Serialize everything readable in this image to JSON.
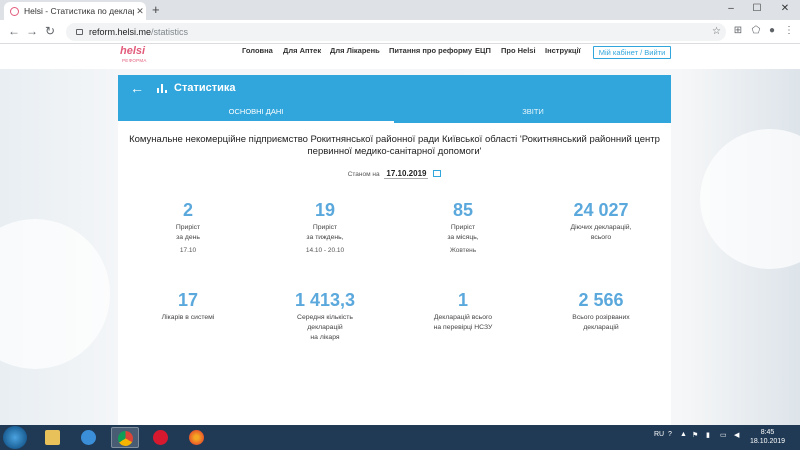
{
  "browser": {
    "tab_title": "Helsi - Статистика по декларац…",
    "url_host": "reform.helsi.me",
    "url_path": "/statistics"
  },
  "header": {
    "logo_text": "helsi",
    "logo_sub": "РЕФОРМА",
    "menu": [
      "Головна",
      "Для Аптек",
      "Для Лікарень",
      "Питання про реформу",
      "ЕЦП",
      "Про Helsi",
      "Інструкції"
    ],
    "cabinet_label": "Мій кабінет / Вийти"
  },
  "card": {
    "title": "Статистика",
    "tabs": [
      "ОСНОВНІ ДАНІ",
      "ЗВІТИ"
    ],
    "org_line1": "Комунальне некомерційне підприємство Рокитнянської районної ради Київської області 'Рокитнянський районний центр",
    "org_line2": "первинної медико-санітарної допомоги'",
    "asof_label": "Станом на",
    "asof_date": "17.10.2019",
    "stats": [
      {
        "num": "2",
        "label": "Приріст\nза день",
        "sub": "17.10"
      },
      {
        "num": "19",
        "label": "Приріст\nза тиждень,",
        "sub": "14.10 - 20.10"
      },
      {
        "num": "85",
        "label": "Приріст\nза місяць,",
        "sub": "Жовтень"
      },
      {
        "num": "24 027",
        "label": "Діючих декларацій,\nвсього",
        "sub": ""
      },
      {
        "num": "17",
        "label": "Лікарів в системі",
        "sub": ""
      },
      {
        "num": "1 413,3",
        "label": "Середня кількість\nдекларацій\nна лікаря",
        "sub": ""
      },
      {
        "num": "1",
        "label": "Декларацій всього\nна перевірці НСЗУ",
        "sub": ""
      },
      {
        "num": "2 566",
        "label": "Всього розірваних\nдекларацій",
        "sub": ""
      }
    ]
  },
  "taskbar": {
    "lang": "RU",
    "time": "8:45",
    "date": "18.10.2019"
  },
  "colors": {
    "accent": "#31a6dc",
    "stat_number": "#5aa8dc",
    "brand": "#e25b7b",
    "taskbar": "#203a55"
  }
}
